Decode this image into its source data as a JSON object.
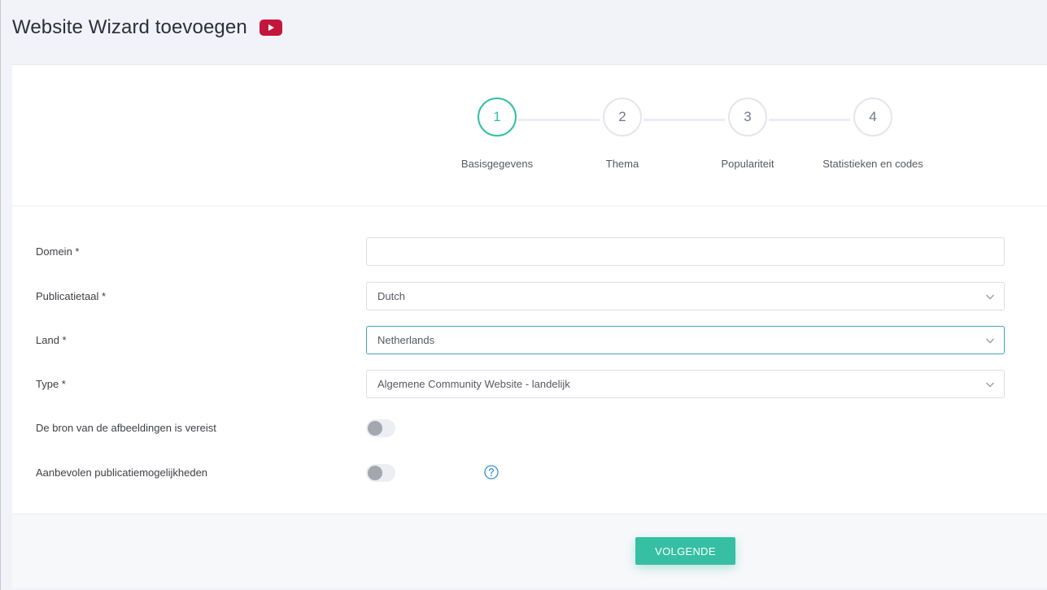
{
  "header": {
    "title": "Website Wizard toevoegen",
    "video_icon": "youtube-icon"
  },
  "colors": {
    "accent": "#34bfa3",
    "youtube": "#c4163d",
    "focus_border": "#3da7b8",
    "help": "#3a8fd1"
  },
  "wizard": {
    "steps": [
      {
        "number": "1",
        "label": "Basisgegevens",
        "active": true
      },
      {
        "number": "2",
        "label": "Thema",
        "active": false
      },
      {
        "number": "3",
        "label": "Populariteit",
        "active": false
      },
      {
        "number": "4",
        "label": "Statistieken en codes",
        "active": false
      }
    ]
  },
  "form": {
    "domain": {
      "label": "Domein *",
      "value": ""
    },
    "language": {
      "label": "Publicatietaal *",
      "value": "Dutch"
    },
    "country": {
      "label": "Land *",
      "value": "Netherlands"
    },
    "type": {
      "label": "Type *",
      "value": "Algemene Community Website - landelijk"
    },
    "image_source": {
      "label": "De bron van de afbeeldingen is vereist",
      "enabled": false
    },
    "recommended": {
      "label": "Aanbevolen publicatiemogelijkheden",
      "enabled": false,
      "help_icon": "question-circle-icon"
    }
  },
  "footer": {
    "next_label": "VOLGENDE"
  }
}
